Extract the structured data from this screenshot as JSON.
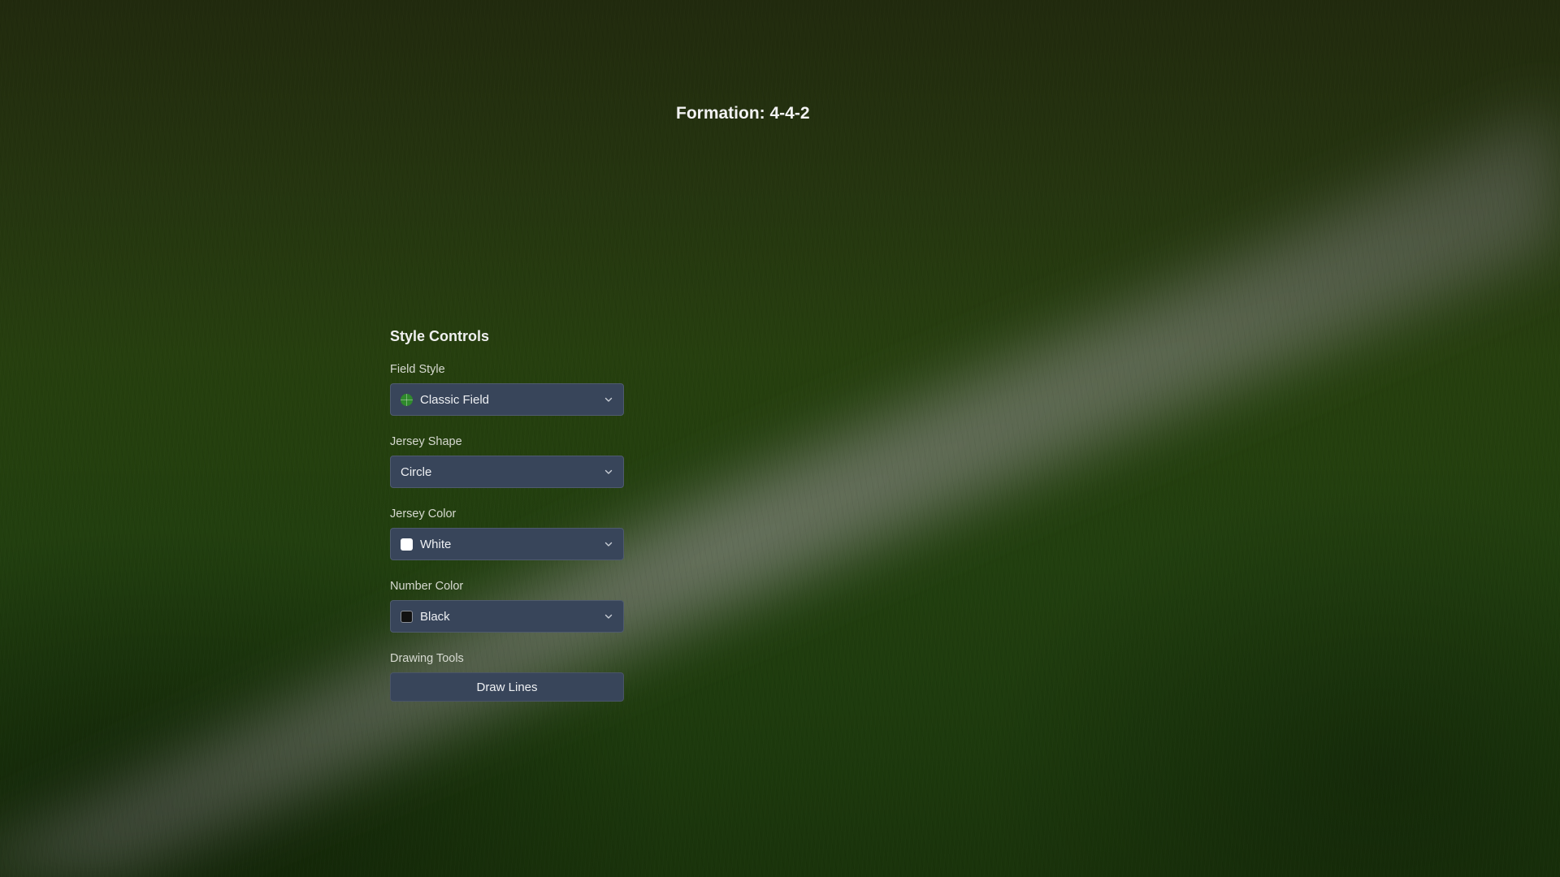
{
  "formation": {
    "title": "Formation: 4-4-2"
  },
  "controls": {
    "title": "Style Controls",
    "field_style": {
      "label": "Field Style",
      "value": "Classic Field",
      "swatch_icon": "field-icon",
      "swatch_color": "#2f8a2c"
    },
    "jersey_shape": {
      "label": "Jersey Shape",
      "value": "Circle"
    },
    "jersey_color": {
      "label": "Jersey Color",
      "value": "White",
      "swatch_color": "#ffffff"
    },
    "number_color": {
      "label": "Number Color",
      "value": "Black",
      "swatch_color": "#111111"
    },
    "drawing_tools": {
      "label": "Drawing Tools",
      "button_label": "Draw Lines"
    }
  },
  "colors": {
    "control_bg": "#38455a",
    "text": "#eef0f3"
  }
}
